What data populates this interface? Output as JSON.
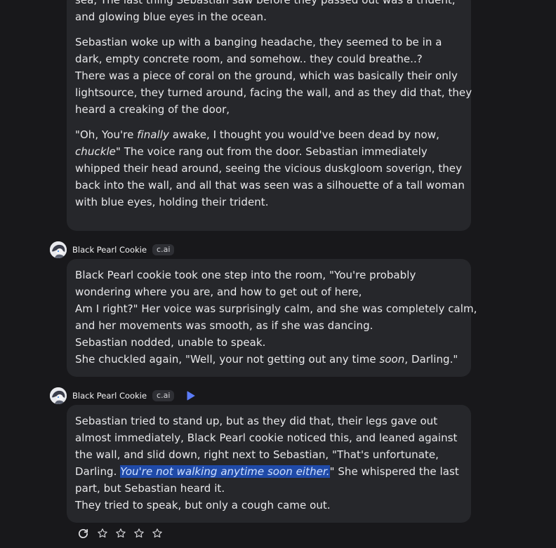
{
  "messages": [
    {
      "lines_p1": [
        "sea, The last thing Sebastian saw before they passed out was a trident,",
        "and glowing blue eyes in the ocean."
      ],
      "lines_p2": [
        "Sebastian woke up with a banging headache, they seemed to be in a",
        "dark, empty concrete room, and somehow.. they could breathe..?",
        "There was a piece of coral on the ground, which was basically their only",
        "lightsource, they turned around, facing the wall, and as they did that, they",
        "heard a creaking of the door,"
      ],
      "p3_line1_a": "\"Oh, You're ",
      "p3_line1_em": "finally",
      "p3_line1_b": " awake, I thought you would've been dead by now,",
      "p3_line2_em": "chuckle",
      "p3_line2_b": "\" The voice rang out from the door. Sebastian immediately",
      "p3_rest": [
        "whipped their head around, seeing the vicious duskgloom soverign, they",
        "back into the wall, and all that was seen was a silhouette of a tall woman",
        "with blue eyes, holding their trident."
      ]
    },
    {
      "author": "Black Pearl Cookie",
      "badge": "c.ai",
      "lines": [
        "Black Pearl cookie took one step into the room, \"You're probably",
        "wondering where you are, and how to get out of here,",
        "Am I right?\" Her voice was surprisingly calm, and she was completely calm,",
        "and her movements was smooth, as if she was dancing.",
        "Sebastian nodded, unable to speak."
      ],
      "last_a": "She chuckled again, \"Well, your not getting out any time ",
      "last_em": "soon",
      "last_b": ", Darling.\""
    },
    {
      "author": "Black Pearl Cookie",
      "badge": "c.ai",
      "lines": [
        "Sebastian tried to stand up, but as they did that, their legs gave out",
        "almost immediately, Black Pearl cookie noticed this, and leaned against",
        "the wall, and slid down, right next to Sebastian, \"That's unfortunate,"
      ],
      "l4_a": "Darling. ",
      "l4_hl": "You're not walking anytime soon either.",
      "l4_b": "\" She whispered the last",
      "rest": [
        "part, but Sebastian heard it.",
        "They tried to speak, but only a cough came out."
      ]
    }
  ],
  "colors": {
    "background": "#18181b",
    "bubble": "#26272b",
    "highlight": "#1f4aa8",
    "accent": "#5b7cf7"
  },
  "icons": {
    "regenerate": "refresh-icon",
    "play": "play-icon",
    "star": "star-outline-icon",
    "avatar": "avatar-icon"
  }
}
